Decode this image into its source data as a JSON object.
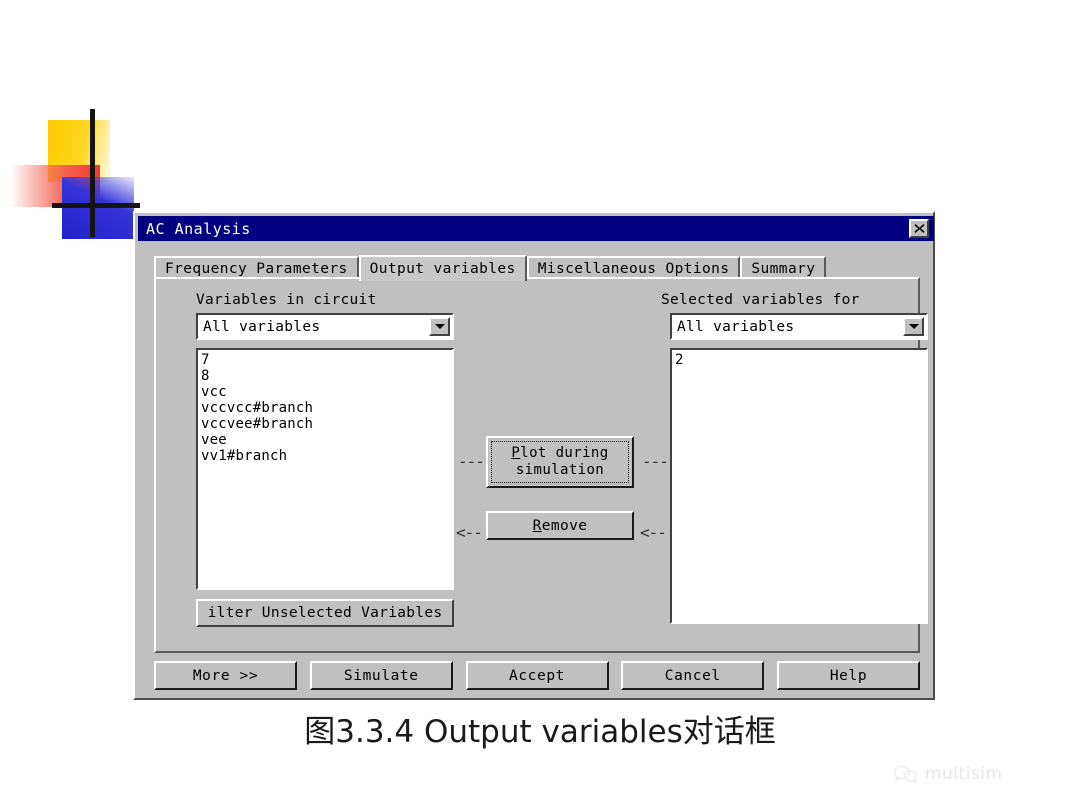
{
  "page": {
    "background_color": "#ffffff",
    "caption": "图3.3.4 Output variables对话框"
  },
  "watermark": {
    "icon": "wechat-bubble-icon",
    "text": "multisim"
  },
  "decor": {
    "name": "decorative-logo",
    "yellow": "#ffcc00",
    "red": "#f03a2e",
    "blue": "#2222cc",
    "cross": "#141414"
  },
  "dialog": {
    "title": "AC Analysis",
    "titlebar_color": "#000080",
    "face_color": "#c0c0c0",
    "close_label": "×",
    "tabs": [
      {
        "label": "Frequency Parameters",
        "active": false
      },
      {
        "label": "Output variables",
        "active": true
      },
      {
        "label": "Miscellaneous Options",
        "active": false
      },
      {
        "label": "Summary",
        "active": false
      }
    ],
    "left_panel": {
      "group_label": "Variables in circuit",
      "combo_value": "All variables",
      "items": [
        "7",
        "8",
        "vcc",
        "vccvcc#branch",
        "vccvee#branch",
        "vee",
        "vv1#branch"
      ],
      "filter_button": "ilter Unselected Variables"
    },
    "right_panel": {
      "group_label": "Selected variables for",
      "combo_value": "All variables",
      "items": [
        "2"
      ]
    },
    "middle": {
      "plot_button_line1": "Plot during",
      "plot_button_line2": "simulation",
      "plot_accel": "P",
      "plot_rest": "lot during",
      "remove_accel": "R",
      "remove_rest": "emove",
      "remove_button": "Remove",
      "arrow_plot_left": "---",
      "arrow_plot_right": "---",
      "arrow_remove_left": "<--",
      "arrow_remove_right": "<--"
    },
    "buttons": [
      {
        "label": "More >>"
      },
      {
        "label": "Simulate"
      },
      {
        "label": "Accept"
      },
      {
        "label": "Cancel"
      },
      {
        "label": "Help"
      }
    ]
  }
}
